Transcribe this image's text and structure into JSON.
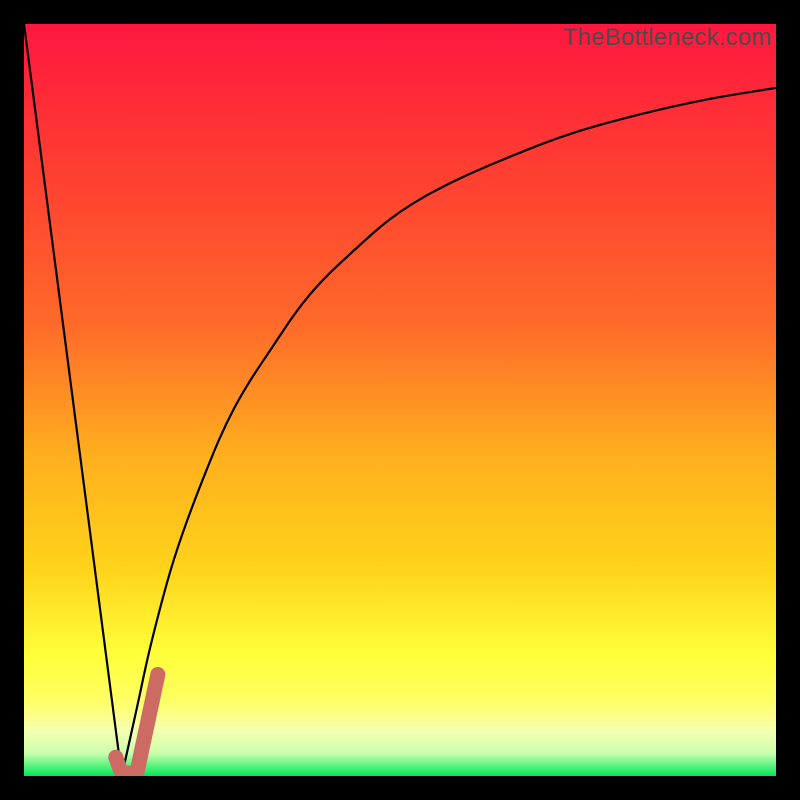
{
  "watermark": "TheBottleneck.com",
  "colors": {
    "frame": "#000000",
    "gradient_top": "#ff173f",
    "gradient_mid1": "#ff6a2a",
    "gradient_mid2": "#ffd21a",
    "gradient_low": "#ffff66",
    "gradient_pale": "#f6ffb0",
    "gradient_bottom": "#00e756",
    "curve": "#000000",
    "marker": "#cc6a63"
  },
  "chart_data": {
    "type": "line",
    "title": "",
    "xlabel": "",
    "ylabel": "",
    "xlim": [
      0,
      100
    ],
    "ylim": [
      0,
      100
    ],
    "series": [
      {
        "name": "left-line",
        "x": [
          0,
          13
        ],
        "y": [
          100,
          0
        ]
      },
      {
        "name": "right-curve",
        "x": [
          13,
          15,
          17,
          20,
          24,
          28,
          33,
          38,
          44,
          50,
          57,
          65,
          73,
          82,
          91,
          100
        ],
        "y": [
          0,
          9,
          18,
          29,
          40,
          49,
          57,
          64,
          70,
          75,
          79,
          82.5,
          85.5,
          88,
          90,
          91.5
        ]
      }
    ],
    "marker": {
      "name": "highlight-hook",
      "points": [
        {
          "x": 12.2,
          "y": 2.5
        },
        {
          "x": 13.2,
          "y": 0.4
        },
        {
          "x": 15.0,
          "y": 0.4
        },
        {
          "x": 17.8,
          "y": 13.5
        }
      ],
      "stroke_width_pct": 2.0
    }
  }
}
